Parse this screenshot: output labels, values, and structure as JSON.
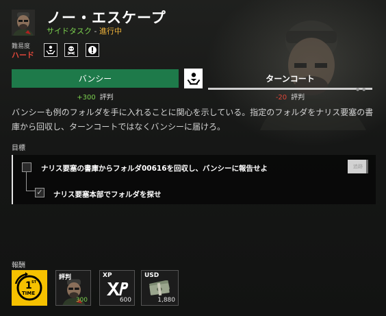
{
  "mission": {
    "title": "ノー・エスケープ",
    "type": "サイドタスク",
    "separator": " - ",
    "status": "進行中"
  },
  "difficulty": {
    "label": "難易度",
    "value": "ハード",
    "icons": [
      "faction-choice-icon",
      "skull-crossbones-icon",
      "alert-icon"
    ]
  },
  "choices": {
    "left": {
      "name": "バンシー",
      "rep_value": "+300",
      "rep_word": "評判"
    },
    "right": {
      "name": "ターンコート",
      "rep_value": "-20",
      "rep_word": "評判"
    },
    "center_icon": "faction-choice-icon"
  },
  "description": "バンシーも例のフォルダを手に入れることに関心を示している。指定のフォルダをナリス要塞の書庫から回収し、ターンコートではなくバンシーに届けろ。",
  "objectives": {
    "header": "目標",
    "items": [
      {
        "text": "ナリス要塞の書庫からフォルダ00616を回収し、バンシーに報告せよ",
        "done": false
      },
      {
        "text": "ナリス要塞本部でフォルダを探せ",
        "done": true
      }
    ],
    "track_label": "追跡"
  },
  "rewards": {
    "header": "報酬",
    "tiles": [
      {
        "kind": "first-time",
        "badge_top": "1",
        "badge_sup": "ST",
        "badge_bottom": "TIME"
      },
      {
        "kind": "reputation",
        "label": "評判",
        "value": "300"
      },
      {
        "kind": "xp",
        "label": "XP",
        "value": "600"
      },
      {
        "kind": "usd",
        "label": "USD",
        "value": "1,880"
      }
    ]
  },
  "colors": {
    "accent_green": "#1e7a4a",
    "positive": "#7cd24f",
    "negative": "#e0473a",
    "status": "#f0b43a",
    "first_time": "#f6c100"
  }
}
